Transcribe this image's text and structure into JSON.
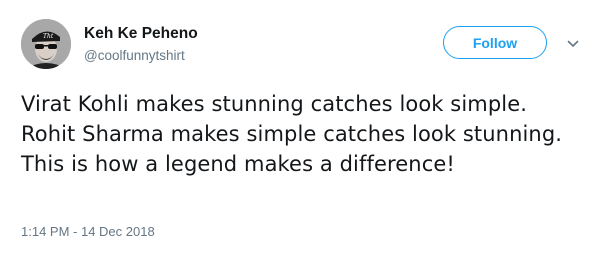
{
  "author": {
    "name": "Keh Ke Peheno",
    "handle": "@coolfunnytshirt",
    "avatar_icon": "profile-avatar"
  },
  "follow_button": {
    "label": "Follow"
  },
  "menu_icon": "chevron-down-icon",
  "tweet": {
    "text": "Virat Kohli makes stunning catches look simple. Rohit Sharma makes simple catches look stunning. This is how a legend makes a difference!",
    "timestamp": "1:14 PM - 14 Dec 2018"
  },
  "colors": {
    "accent": "#1da1f2",
    "secondary_text": "#657786",
    "primary_text": "#14171a"
  }
}
